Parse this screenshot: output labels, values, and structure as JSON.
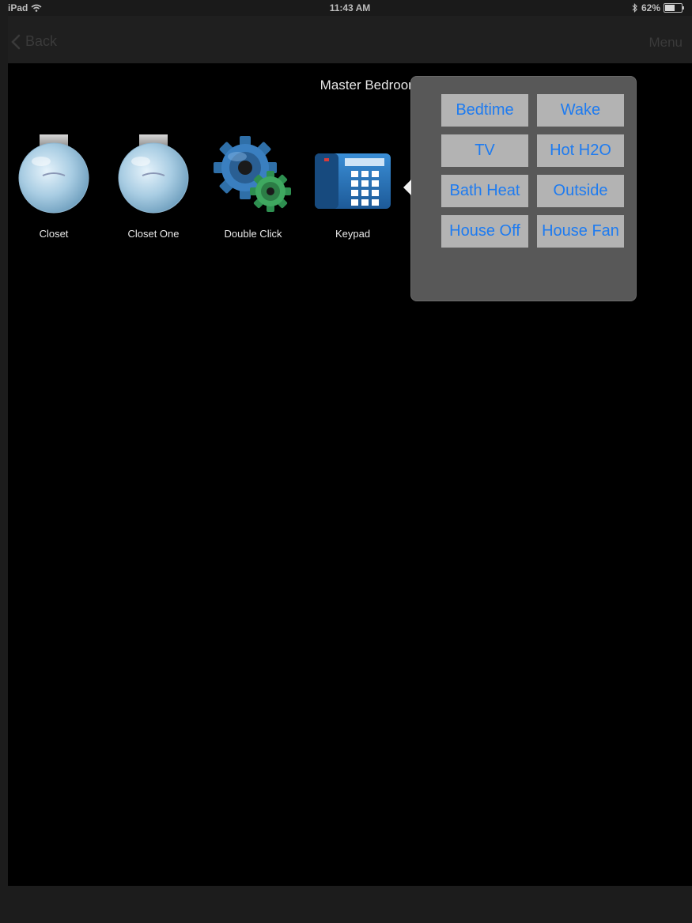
{
  "status_bar": {
    "device": "iPad",
    "time": "11:43 AM",
    "battery": "62%",
    "battery_level": 0.62
  },
  "nav": {
    "back_label": "Back",
    "menu_label": "Menu"
  },
  "room": {
    "title": "Master Bedroom"
  },
  "devices": [
    {
      "label": "Closet",
      "icon": "lightbulb-icon"
    },
    {
      "label": "Closet One",
      "icon": "lightbulb-icon"
    },
    {
      "label": "Double Click",
      "icon": "gears-icon"
    },
    {
      "label": "Keypad",
      "icon": "keypad-icon"
    }
  ],
  "scenes": [
    {
      "label": "Bedtime"
    },
    {
      "label": "Wake"
    },
    {
      "label": "TV"
    },
    {
      "label": "Hot H2O"
    },
    {
      "label": "Bath Heat"
    },
    {
      "label": "Outside"
    },
    {
      "label": "House Off"
    },
    {
      "label": "House Fan"
    }
  ],
  "colors": {
    "accent": "#1e7bf0",
    "scene_button_bg": "#b3b3b3",
    "popover_bg": "#585858"
  }
}
